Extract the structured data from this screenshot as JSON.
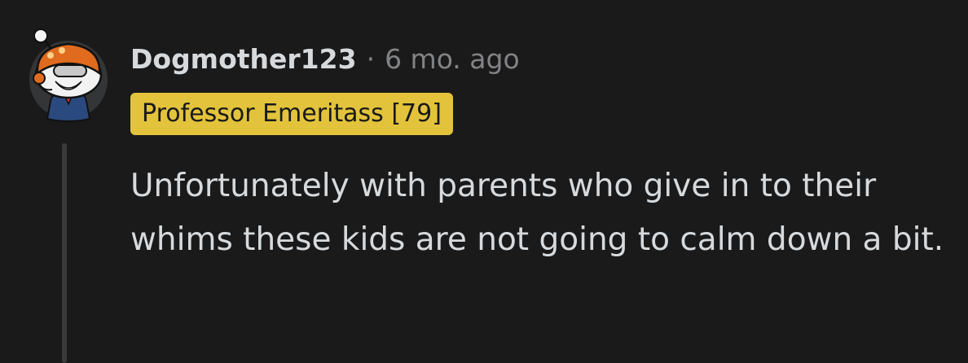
{
  "comment": {
    "username": "Dogmother123",
    "separator": "·",
    "timestamp": "6 mo. ago",
    "flair": "Professor Emeritass [79]",
    "body": "Unfortunately with parents who give in to their whims these kids are not going to calm down a bit."
  },
  "colors": {
    "background": "#1a1a1b",
    "text": "#d7dadc",
    "muted": "#818384",
    "flair_bg": "#e3c33b",
    "flair_text": "#1a1a1b"
  },
  "icons": {
    "avatar": "snoo-avatar-icon"
  }
}
